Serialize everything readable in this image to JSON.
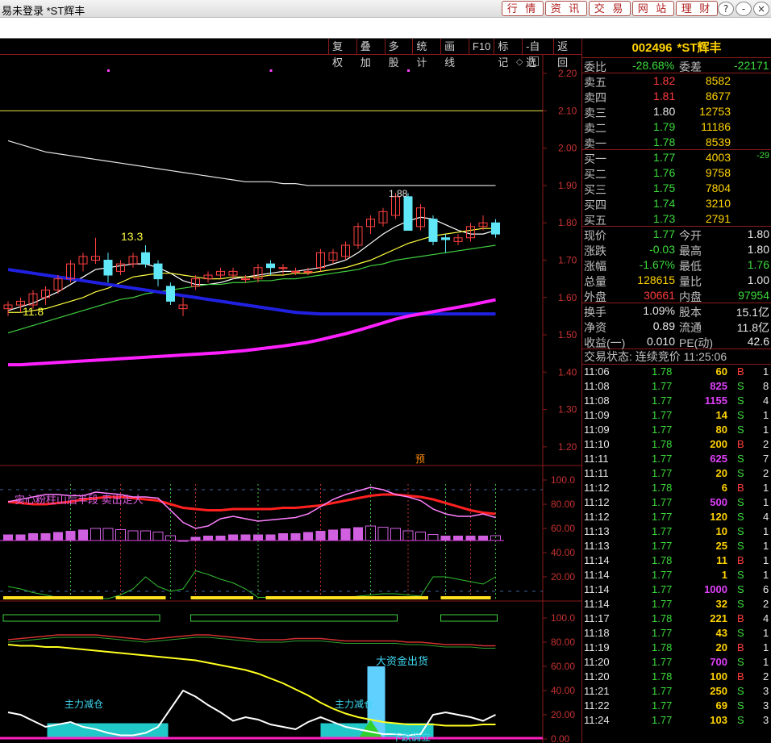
{
  "window": {
    "title": "易未登录  *ST辉丰",
    "nav_buttons": [
      "行 情",
      "资 讯",
      "交 易",
      "网 站",
      "理 财"
    ],
    "win_buttons": [
      "?",
      "-",
      "×"
    ]
  },
  "toolbar": {
    "buttons": [
      "复权",
      "叠加",
      "多股",
      "统计",
      "画线",
      "F10",
      "标记",
      "-自选",
      "返回"
    ],
    "diamond_icon": "◇",
    "close_icon": "×"
  },
  "quote": {
    "code": "002496",
    "name": "*ST辉丰",
    "weibi_label": "委比",
    "weibi_value": "-28.68%",
    "weicha_label": "委差",
    "weicha_value": "-22171",
    "asks": [
      {
        "label": "卖五",
        "price": "1.82",
        "vol": "8582",
        "color": "red"
      },
      {
        "label": "卖四",
        "price": "1.81",
        "vol": "8677",
        "color": "red"
      },
      {
        "label": "卖三",
        "price": "1.80",
        "vol": "12753",
        "color": "white"
      },
      {
        "label": "卖二",
        "price": "1.79",
        "vol": "11186",
        "color": "green"
      },
      {
        "label": "卖一",
        "price": "1.78",
        "vol": "8539",
        "color": "green"
      }
    ],
    "bids": [
      {
        "label": "买一",
        "price": "1.77",
        "vol": "4003",
        "extra": "-29"
      },
      {
        "label": "买二",
        "price": "1.76",
        "vol": "9758",
        "extra": ""
      },
      {
        "label": "买三",
        "price": "1.75",
        "vol": "7804",
        "extra": ""
      },
      {
        "label": "买四",
        "price": "1.74",
        "vol": "3210",
        "extra": ""
      },
      {
        "label": "买五",
        "price": "1.73",
        "vol": "2791",
        "extra": ""
      }
    ],
    "stats1": [
      {
        "l1": "现价",
        "v1": "1.77",
        "c1": "green",
        "l2": "今开",
        "v2": "1.80",
        "c2": "white"
      },
      {
        "l1": "涨跌",
        "v1": "-0.03",
        "c1": "green",
        "l2": "最高",
        "v2": "1.80",
        "c2": "white"
      },
      {
        "l1": "涨幅",
        "v1": "-1.67%",
        "c1": "green",
        "l2": "最低",
        "v2": "1.76",
        "c2": "green"
      },
      {
        "l1": "总量",
        "v1": "128615",
        "c1": "yellow",
        "l2": "量比",
        "v2": "1.00",
        "c2": "white"
      },
      {
        "l1": "外盘",
        "v1": "30661",
        "c1": "red",
        "l2": "内盘",
        "v2": "97954",
        "c2": "green"
      }
    ],
    "stats2": [
      {
        "l1": "换手",
        "v1": "1.09%",
        "l2": "股本",
        "v2": "15.1亿"
      },
      {
        "l1": "净资",
        "v1": "0.89",
        "l2": "流通",
        "v2": "11.8亿"
      },
      {
        "l1": "收益(一)",
        "v1": "0.010",
        "l2": "PE(动)",
        "v2": "42.6"
      }
    ],
    "trade_status": "交易状态: 连续竞价 11:25:06"
  },
  "ticks": [
    {
      "t": "11:06",
      "p": "1.78",
      "v": "60",
      "bs": "B",
      "n": "1"
    },
    {
      "t": "11:08",
      "p": "1.77",
      "v": "825",
      "bs": "S",
      "n": "8"
    },
    {
      "t": "11:08",
      "p": "1.77",
      "v": "1155",
      "bs": "S",
      "n": "4"
    },
    {
      "t": "11:09",
      "p": "1.77",
      "v": "14",
      "bs": "S",
      "n": "1"
    },
    {
      "t": "11:09",
      "p": "1.77",
      "v": "80",
      "bs": "S",
      "n": "1"
    },
    {
      "t": "11:10",
      "p": "1.78",
      "v": "200",
      "bs": "B",
      "n": "2"
    },
    {
      "t": "11:11",
      "p": "1.77",
      "v": "625",
      "bs": "S",
      "n": "7"
    },
    {
      "t": "11:11",
      "p": "1.77",
      "v": "20",
      "bs": "S",
      "n": "2"
    },
    {
      "t": "11:12",
      "p": "1.78",
      "v": "6",
      "bs": "B",
      "n": "1"
    },
    {
      "t": "11:12",
      "p": "1.77",
      "v": "500",
      "bs": "S",
      "n": "1"
    },
    {
      "t": "11:12",
      "p": "1.77",
      "v": "120",
      "bs": "S",
      "n": "4"
    },
    {
      "t": "11:13",
      "p": "1.77",
      "v": "10",
      "bs": "S",
      "n": "1"
    },
    {
      "t": "11:13",
      "p": "1.77",
      "v": "25",
      "bs": "S",
      "n": "1"
    },
    {
      "t": "11:14",
      "p": "1.78",
      "v": "11",
      "bs": "B",
      "n": "1"
    },
    {
      "t": "11:14",
      "p": "1.77",
      "v": "1",
      "bs": "S",
      "n": "1"
    },
    {
      "t": "11:14",
      "p": "1.77",
      "v": "1000",
      "bs": "S",
      "n": "6"
    },
    {
      "t": "11:14",
      "p": "1.77",
      "v": "32",
      "bs": "S",
      "n": "2"
    },
    {
      "t": "11:17",
      "p": "1.78",
      "v": "221",
      "bs": "B",
      "n": "4"
    },
    {
      "t": "11:18",
      "p": "1.77",
      "v": "43",
      "bs": "S",
      "n": "1"
    },
    {
      "t": "11:19",
      "p": "1.78",
      "v": "20",
      "bs": "B",
      "n": "1"
    },
    {
      "t": "11:20",
      "p": "1.77",
      "v": "700",
      "bs": "S",
      "n": "1"
    },
    {
      "t": "11:20",
      "p": "1.78",
      "v": "100",
      "bs": "B",
      "n": "2"
    },
    {
      "t": "11:21",
      "p": "1.77",
      "v": "250",
      "bs": "S",
      "n": "3"
    },
    {
      "t": "11:22",
      "p": "1.77",
      "v": "69",
      "bs": "S",
      "n": "3"
    },
    {
      "t": "11:24",
      "p": "1.77",
      "v": "103",
      "bs": "S",
      "n": "3"
    }
  ],
  "chart_data": {
    "type": "candlestick",
    "price_axis": [
      "2.20",
      "2.10",
      "2.00",
      "1.90",
      "1.80",
      "1.70",
      "1.60",
      "1.50",
      "1.40",
      "1.30",
      "1.20"
    ],
    "ylim": [
      1.15,
      2.25
    ],
    "annotations": {
      "high_label": "13.3",
      "low_label": "11.8",
      "peak_label": "1.88",
      "yu_label": "预"
    },
    "candles": [
      {
        "o": 1.57,
        "h": 1.59,
        "l": 1.55,
        "c": 1.58
      },
      {
        "o": 1.58,
        "h": 1.6,
        "l": 1.56,
        "c": 1.59
      },
      {
        "o": 1.58,
        "h": 1.62,
        "l": 1.57,
        "c": 1.61
      },
      {
        "o": 1.6,
        "h": 1.63,
        "l": 1.58,
        "c": 1.62
      },
      {
        "o": 1.62,
        "h": 1.66,
        "l": 1.61,
        "c": 1.65
      },
      {
        "o": 1.65,
        "h": 1.7,
        "l": 1.64,
        "c": 1.69
      },
      {
        "o": 1.69,
        "h": 1.72,
        "l": 1.67,
        "c": 1.71
      },
      {
        "o": 1.7,
        "h": 1.76,
        "l": 1.69,
        "c": 1.71
      },
      {
        "o": 1.7,
        "h": 1.72,
        "l": 1.64,
        "c": 1.66
      },
      {
        "o": 1.67,
        "h": 1.7,
        "l": 1.66,
        "c": 1.69
      },
      {
        "o": 1.69,
        "h": 1.72,
        "l": 1.68,
        "c": 1.71
      },
      {
        "o": 1.72,
        "h": 1.74,
        "l": 1.68,
        "c": 1.69
      },
      {
        "o": 1.69,
        "h": 1.7,
        "l": 1.63,
        "c": 1.65
      },
      {
        "o": 1.63,
        "h": 1.64,
        "l": 1.58,
        "c": 1.59
      },
      {
        "o": 1.57,
        "h": 1.6,
        "l": 1.55,
        "c": 1.58
      },
      {
        "o": 1.63,
        "h": 1.66,
        "l": 1.62,
        "c": 1.65
      },
      {
        "o": 1.65,
        "h": 1.67,
        "l": 1.64,
        "c": 1.66
      },
      {
        "o": 1.66,
        "h": 1.68,
        "l": 1.65,
        "c": 1.67
      },
      {
        "o": 1.66,
        "h": 1.68,
        "l": 1.65,
        "c": 1.67
      },
      {
        "o": 1.65,
        "h": 1.66,
        "l": 1.64,
        "c": 1.65
      },
      {
        "o": 1.65,
        "h": 1.69,
        "l": 1.64,
        "c": 1.68
      },
      {
        "o": 1.69,
        "h": 1.7,
        "l": 1.66,
        "c": 1.68
      },
      {
        "o": 1.68,
        "h": 1.69,
        "l": 1.66,
        "c": 1.68
      },
      {
        "o": 1.67,
        "h": 1.68,
        "l": 1.66,
        "c": 1.67
      },
      {
        "o": 1.67,
        "h": 1.68,
        "l": 1.66,
        "c": 1.67
      },
      {
        "o": 1.68,
        "h": 1.73,
        "l": 1.67,
        "c": 1.72
      },
      {
        "o": 1.7,
        "h": 1.73,
        "l": 1.69,
        "c": 1.72
      },
      {
        "o": 1.71,
        "h": 1.75,
        "l": 1.7,
        "c": 1.74
      },
      {
        "o": 1.74,
        "h": 1.8,
        "l": 1.73,
        "c": 1.79
      },
      {
        "o": 1.79,
        "h": 1.82,
        "l": 1.77,
        "c": 1.81
      },
      {
        "o": 1.8,
        "h": 1.84,
        "l": 1.79,
        "c": 1.83
      },
      {
        "o": 1.82,
        "h": 1.88,
        "l": 1.81,
        "c": 1.87
      },
      {
        "o": 1.87,
        "h": 1.88,
        "l": 1.78,
        "c": 1.78
      },
      {
        "o": 1.79,
        "h": 1.85,
        "l": 1.78,
        "c": 1.84
      },
      {
        "o": 1.81,
        "h": 1.82,
        "l": 1.74,
        "c": 1.75
      },
      {
        "o": 1.76,
        "h": 1.77,
        "l": 1.72,
        "c": 1.755
      },
      {
        "o": 1.75,
        "h": 1.77,
        "l": 1.74,
        "c": 1.76
      },
      {
        "o": 1.76,
        "h": 1.8,
        "l": 1.75,
        "c": 1.79
      },
      {
        "o": 1.79,
        "h": 1.82,
        "l": 1.78,
        "c": 1.8
      },
      {
        "o": 1.8,
        "h": 1.81,
        "l": 1.76,
        "c": 1.77
      }
    ],
    "ma_lines": [
      {
        "name": "MA5",
        "color": "#ffffff",
        "values": [
          1.565,
          1.575,
          1.585,
          1.6,
          1.615,
          1.635,
          1.655,
          1.675,
          1.68,
          1.685,
          1.69,
          1.69,
          1.68,
          1.665,
          1.645,
          1.635,
          1.635,
          1.64,
          1.65,
          1.655,
          1.66,
          1.665,
          1.67,
          1.67,
          1.675,
          1.68,
          1.69,
          1.7,
          1.72,
          1.745,
          1.77,
          1.79,
          1.805,
          1.815,
          1.81,
          1.795,
          1.78,
          1.77,
          1.77,
          1.78
        ]
      },
      {
        "name": "MA10",
        "color": "#ffff40",
        "values": [
          1.56,
          1.56,
          1.565,
          1.57,
          1.58,
          1.59,
          1.6,
          1.615,
          1.625,
          1.64,
          1.655,
          1.66,
          1.665,
          1.665,
          1.66,
          1.655,
          1.65,
          1.65,
          1.655,
          1.655,
          1.655,
          1.66,
          1.66,
          1.665,
          1.665,
          1.67,
          1.675,
          1.68,
          1.69,
          1.7,
          1.715,
          1.73,
          1.745,
          1.755,
          1.765,
          1.77,
          1.775,
          1.78,
          1.785,
          1.785
        ]
      },
      {
        "name": "MA20",
        "color": "#40d040",
        "values": [
          1.505,
          1.515,
          1.525,
          1.535,
          1.545,
          1.555,
          1.565,
          1.575,
          1.585,
          1.595,
          1.6,
          1.61,
          1.615,
          1.62,
          1.625,
          1.63,
          1.635,
          1.635,
          1.64,
          1.64,
          1.645,
          1.645,
          1.65,
          1.65,
          1.655,
          1.66,
          1.665,
          1.67,
          1.675,
          1.685,
          1.69,
          1.7,
          1.705,
          1.71,
          1.715,
          1.72,
          1.725,
          1.73,
          1.735,
          1.74
        ]
      },
      {
        "name": "MA60",
        "color": "#e8e8e8",
        "values": [
          2.02,
          2.01,
          2.0,
          1.99,
          1.985,
          1.98,
          1.975,
          1.97,
          1.965,
          1.96,
          1.955,
          1.95,
          1.945,
          1.94,
          1.935,
          1.93,
          1.925,
          1.92,
          1.915,
          1.91,
          1.91,
          1.91,
          1.905,
          1.905,
          1.9,
          1.9,
          1.9,
          1.9,
          1.9,
          1.9,
          1.9,
          1.9,
          1.9,
          1.9,
          1.9,
          1.9,
          1.9,
          1.9,
          1.9,
          1.9
        ]
      },
      {
        "name": "MA-blue",
        "color": "#2020e0",
        "values": [
          1.675,
          1.67,
          1.665,
          1.66,
          1.655,
          1.65,
          1.645,
          1.64,
          1.635,
          1.63,
          1.625,
          1.62,
          1.615,
          1.61,
          1.605,
          1.6,
          1.595,
          1.59,
          1.585,
          1.58,
          1.575,
          1.57,
          1.565,
          1.56,
          1.558,
          1.556,
          1.556,
          1.556,
          1.556,
          1.556,
          1.556,
          1.556,
          1.556,
          1.556,
          1.556,
          1.556,
          1.556,
          1.556,
          1.556,
          1.556
        ]
      },
      {
        "name": "MA-magenta",
        "color": "#ff20ff",
        "values": [
          1.42,
          1.42,
          1.422,
          1.424,
          1.426,
          1.428,
          1.43,
          1.432,
          1.434,
          1.436,
          1.438,
          1.44,
          1.442,
          1.444,
          1.446,
          1.448,
          1.45,
          1.452,
          1.455,
          1.458,
          1.462,
          1.466,
          1.47,
          1.475,
          1.48,
          1.487,
          1.495,
          1.503,
          1.512,
          1.522,
          1.532,
          1.542,
          1.55,
          1.556,
          1.562,
          1.568,
          1.574,
          1.58,
          1.587,
          1.594
        ]
      }
    ],
    "yellow_line": {
      "y": 2.1
    },
    "purple_dots": [
      8,
      21,
      32
    ],
    "indicator1": {
      "title": "实心粉柱山后半段  卖出走人",
      "axis": [
        "100.0",
        "80.00",
        "60.00",
        "40.00",
        "20.00"
      ],
      "red_line": [
        82,
        81,
        80,
        80,
        81,
        82,
        84,
        85,
        86,
        86,
        85,
        84,
        83,
        80,
        77,
        76,
        75,
        75,
        76,
        76,
        76,
        76,
        77,
        77,
        78,
        79,
        81,
        83,
        85,
        87,
        88,
        88,
        87,
        86,
        84,
        81,
        78,
        75,
        73,
        72
      ],
      "pink_line": [
        82,
        84,
        86,
        88,
        88,
        87,
        87,
        90,
        89,
        88,
        86,
        86,
        85,
        75,
        65,
        60,
        62,
        68,
        70,
        68,
        66,
        67,
        68,
        69,
        72,
        78,
        84,
        88,
        91,
        94,
        92,
        88,
        86,
        83,
        76,
        72,
        70,
        70,
        72,
        69
      ],
      "bars": [
        55,
        55,
        56,
        56,
        57,
        58,
        59,
        60,
        60,
        59,
        58,
        58,
        57,
        54,
        50,
        53,
        54,
        54,
        55,
        55,
        55,
        55,
        56,
        56,
        57,
        58,
        59,
        60,
        61,
        62,
        61,
        60,
        58,
        57,
        55,
        54,
        54,
        54,
        54,
        54
      ],
      "bar_solid": [
        true,
        true,
        true,
        true,
        true,
        true,
        true,
        false,
        false,
        false,
        false,
        false,
        false,
        false,
        false,
        true,
        true,
        true,
        true,
        true,
        true,
        true,
        true,
        true,
        true,
        true,
        true,
        true,
        true,
        false,
        false,
        false,
        false,
        false,
        false,
        true,
        true,
        true,
        true,
        false
      ],
      "green_line": [
        12,
        10,
        7,
        5,
        3,
        2,
        2,
        2,
        2,
        5,
        10,
        20,
        12,
        8,
        10,
        25,
        22,
        18,
        15,
        10,
        3,
        3,
        3,
        3,
        3,
        3,
        3,
        3,
        4,
        5,
        6,
        6,
        5,
        4,
        20,
        20,
        18,
        16,
        14,
        20
      ]
    },
    "indicator2": {
      "axis": [
        "100.0",
        "80.00",
        "60.00",
        "40.00",
        "20.00",
        "0.00"
      ],
      "labels": {
        "main_reduce_1": "主力减仓",
        "main_reduce_2": "主力减仓",
        "big_funds_out": "大资金出货",
        "decline_confirmed": "下跌确立"
      },
      "yellow_line": [
        78,
        77,
        77,
        76,
        76,
        75,
        74,
        73,
        72,
        71,
        70,
        69,
        68,
        67,
        66,
        65,
        63,
        61,
        59,
        57,
        54,
        50,
        46,
        41,
        36,
        30,
        25,
        21,
        18,
        16,
        14,
        13,
        12,
        12,
        12,
        11,
        11,
        11,
        12,
        12
      ],
      "white_line": [
        22,
        20,
        15,
        10,
        12,
        14,
        10,
        8,
        5,
        3,
        3,
        5,
        10,
        25,
        40,
        35,
        28,
        22,
        15,
        18,
        16,
        12,
        10,
        8,
        14,
        18,
        14,
        10,
        8,
        6,
        4,
        4,
        3,
        4,
        20,
        22,
        20,
        18,
        15,
        20
      ],
      "red_line": [
        82,
        83,
        84,
        85,
        86,
        86,
        86,
        86,
        85,
        84,
        83,
        82,
        83,
        84,
        85,
        86,
        86,
        85,
        84,
        83,
        82,
        82,
        82,
        83,
        83,
        83,
        82,
        81,
        81,
        81,
        81,
        81,
        80,
        80,
        79,
        78,
        78,
        78,
        77,
        77
      ],
      "green_line": [
        80,
        81,
        82,
        83,
        84,
        84,
        84,
        84,
        83,
        82,
        81,
        80,
        81,
        82,
        83,
        84,
        84,
        83,
        82,
        81,
        80,
        80,
        80,
        81,
        81,
        81,
        80,
        79,
        79,
        79,
        79,
        79,
        78,
        78,
        77,
        76,
        76,
        76,
        75,
        75
      ]
    }
  }
}
